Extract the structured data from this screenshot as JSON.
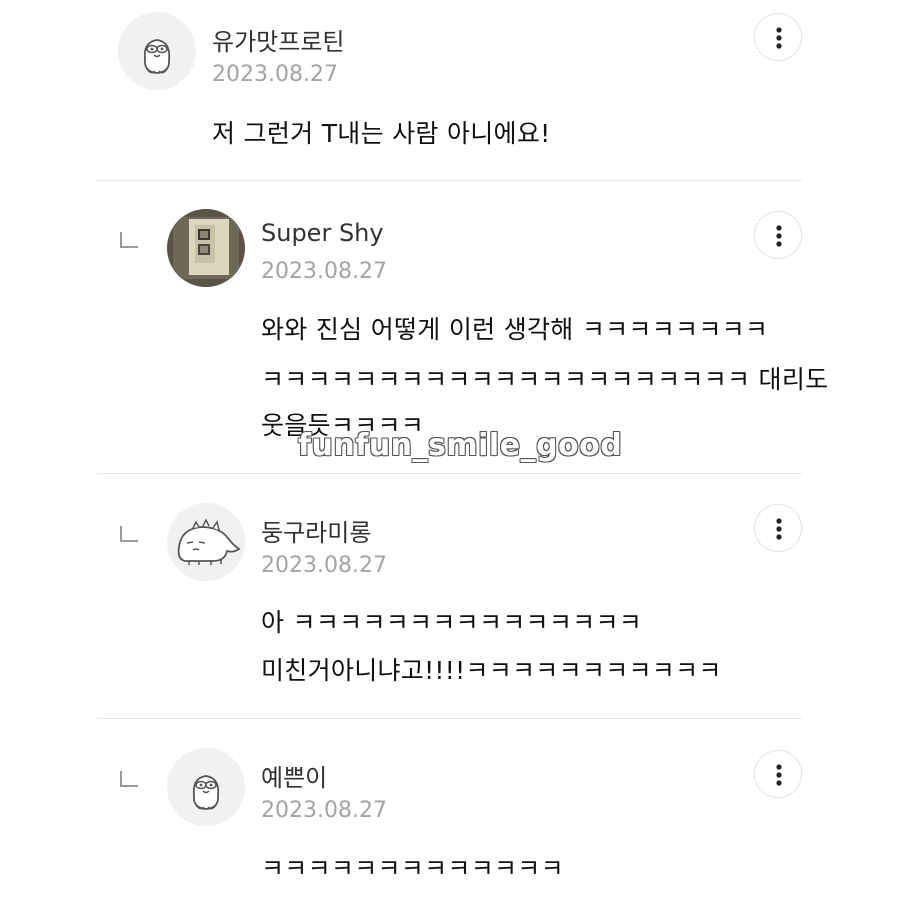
{
  "comments": [
    {
      "nickname": "유가맛프로틴",
      "date": "2023.08.27",
      "lines": [
        "저 그런거 T내는 사람 아니에요!"
      ],
      "is_reply": false,
      "avatar_icon": "chick-sticker-icon"
    },
    {
      "nickname": "Super Shy",
      "date": "2023.08.27",
      "lines": [
        "와와 진심 어떻게 이런 생각해 ㅋㅋㅋㅋㅋㅋㅋㅋ",
        "ㅋㅋㅋㅋㅋㅋㅋㅋㅋㅋㅋㅋㅋㅋㅋㅋㅋㅋㅋㅋㅋ 대리도",
        "웃을듯ㅋㅋㅋㅋ"
      ],
      "is_reply": true,
      "avatar_icon": "photo-avatar-icon"
    },
    {
      "nickname": "둥구라미롱",
      "date": "2023.08.27",
      "lines": [
        "아 ㅋㅋㅋㅋㅋㅋㅋㅋㅋㅋㅋㅋㅋㅋㅋ",
        "미친거아니냐고!!!!ㅋㅋㅋㅋㅋㅋㅋㅋㅋㅋㅋ"
      ],
      "is_reply": true,
      "avatar_icon": "dinosaur-sticker-icon"
    },
    {
      "nickname": "예쁜이",
      "date": "2023.08.27",
      "lines": [
        "ㅋㅋㅋㅋㅋㅋㅋㅋㅋㅋㅋㅋㅋ"
      ],
      "is_reply": true,
      "avatar_icon": "chick-sticker-icon"
    }
  ],
  "watermark": "funfun_smile_good",
  "more_icon": "more-vertical-icon",
  "reply_icon": "reply-arrow-icon",
  "colors": {
    "nickname": "#333333",
    "date": "#a4a4a4",
    "divider": "#e6e6e6",
    "avatar_bg": "#f1f1f1"
  }
}
